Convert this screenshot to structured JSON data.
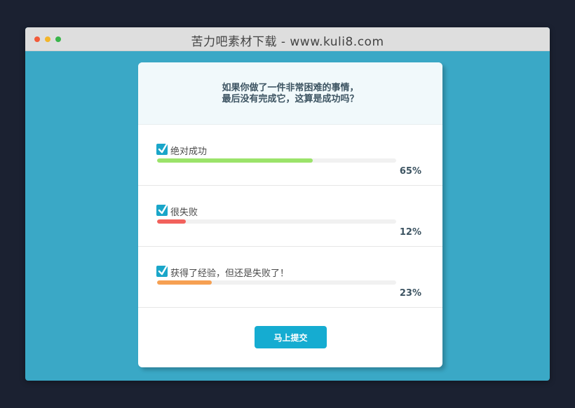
{
  "window": {
    "title": "苦力吧素材下载 - www.kuli8.com"
  },
  "poll": {
    "question_line1": "如果你做了一件非常困难的事情，",
    "question_line2": "最后没有完成它，这算是成功吗？",
    "options": [
      {
        "label": "绝对成功",
        "percent_text": "65%",
        "percent": 65,
        "color": "#9be36a"
      },
      {
        "label": "很失败",
        "percent_text": "12%",
        "percent": 12,
        "color": "#f2615c"
      },
      {
        "label": "获得了经验，但还是失败了！",
        "percent_text": "23%",
        "percent": 23,
        "color": "#f6a052"
      }
    ],
    "submit_label": "马上提交"
  },
  "colors": {
    "accent": "#15acd1",
    "background": "#3aa8c6",
    "page": "#1b2131"
  },
  "icons": {
    "checkbox": "checkbox-checked-icon"
  }
}
